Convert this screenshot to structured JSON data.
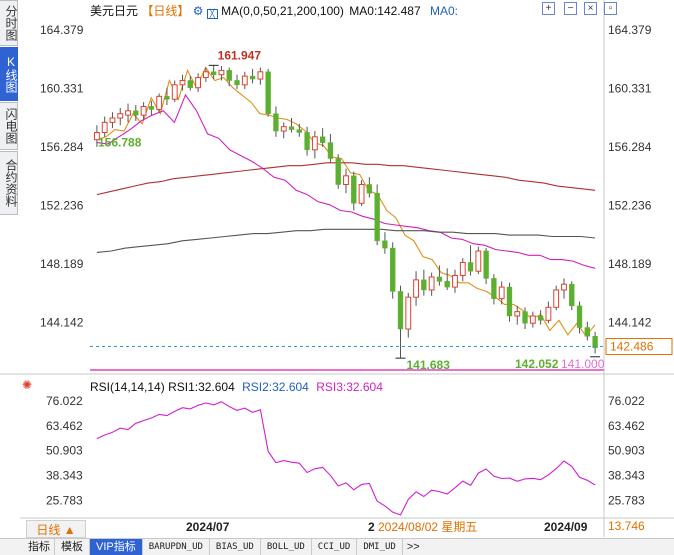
{
  "left_tabs": [
    "分时图",
    "K线图",
    "闪电图",
    "合约资料"
  ],
  "active_left_tab": 1,
  "header": {
    "symbol": "美元日元",
    "period": "【日线】",
    "ma_label": "MA(0,0,50,21,200,100)",
    "ma0_label": "MA0:142.487",
    "ma0b_label": "MA0:"
  },
  "rsi_header": {
    "title": "RSI(14,14,14)",
    "rsi1": "RSI1:32.604",
    "rsi2": "RSI2:32.604",
    "rsi3": "RSI3:32.604"
  },
  "colors": {
    "up": "#e04030",
    "down": "#5cb030",
    "ma_orange": "#e0901a",
    "ma_magenta": "#d020c0",
    "ma_darkred": "#b03030",
    "ma_gray": "#555555",
    "rsi": "#d020d0",
    "current_line": "#2a9fc0",
    "min_line": "#e040c0",
    "label_blue": "#2060c0"
  },
  "icons": [
    "add-box-icon",
    "minus-box-icon",
    "cross-box-icon",
    "expand-box-icon",
    "collapse-box-icon",
    "settings-gear-icon"
  ],
  "bottom_tabs": [
    "指标",
    "模板"
  ],
  "active_indicator_tab": "VIP指标",
  "indicator_tabs": [
    "BARUPDN_UD",
    "BIAS_UD",
    "BOLL_UD",
    "CCI_UD",
    "DMI_UD"
  ],
  "more_label": ">>",
  "period_label": "日线 ▲",
  "chart_data": {
    "type": "candlestick",
    "price_axis": {
      "ticks": [
        "164.379",
        "160.331",
        "156.284",
        "152.236",
        "148.189",
        "144.142"
      ],
      "ylim": [
        141.0,
        165.5
      ]
    },
    "rsi_axis": {
      "ticks": [
        "76.022",
        "63.462",
        "50.903",
        "38.343",
        "25.783"
      ],
      "ylim": [
        19.0,
        80.5
      ],
      "right_extra_label": "13.746"
    },
    "x_labels": [
      "2024/07",
      "2",
      "2024/09"
    ],
    "cursor_date_label": "2024/08/02 星期五",
    "annotations": {
      "high": "161.947",
      "left_value": "156.788",
      "low": "141.683",
      "last_close": "142.052",
      "min_level": "141.000",
      "current_price": "142.486"
    },
    "candles": [
      {
        "o": 156.8,
        "h": 157.8,
        "l": 156.3,
        "c": 157.3
      },
      {
        "o": 157.3,
        "h": 158.4,
        "l": 157.0,
        "c": 158.0
      },
      {
        "o": 158.0,
        "h": 158.7,
        "l": 157.6,
        "c": 158.3
      },
      {
        "o": 158.3,
        "h": 159.0,
        "l": 157.8,
        "c": 158.6
      },
      {
        "o": 158.5,
        "h": 159.3,
        "l": 158.0,
        "c": 158.8
      },
      {
        "o": 158.8,
        "h": 159.2,
        "l": 158.1,
        "c": 158.5
      },
      {
        "o": 158.5,
        "h": 159.4,
        "l": 158.2,
        "c": 159.1
      },
      {
        "o": 159.1,
        "h": 159.5,
        "l": 158.5,
        "c": 158.9
      },
      {
        "o": 158.9,
        "h": 160.0,
        "l": 158.7,
        "c": 159.8
      },
      {
        "o": 159.8,
        "h": 160.4,
        "l": 159.2,
        "c": 159.6
      },
      {
        "o": 159.6,
        "h": 160.9,
        "l": 159.4,
        "c": 160.6
      },
      {
        "o": 160.6,
        "h": 161.3,
        "l": 160.2,
        "c": 160.9
      },
      {
        "o": 160.9,
        "h": 161.2,
        "l": 160.2,
        "c": 160.4
      },
      {
        "o": 160.4,
        "h": 161.4,
        "l": 160.1,
        "c": 161.1
      },
      {
        "o": 161.1,
        "h": 161.8,
        "l": 160.8,
        "c": 161.5
      },
      {
        "o": 161.5,
        "h": 161.95,
        "l": 161.0,
        "c": 161.3
      },
      {
        "o": 161.3,
        "h": 161.9,
        "l": 160.9,
        "c": 161.6
      },
      {
        "o": 161.6,
        "h": 161.8,
        "l": 160.5,
        "c": 160.9
      },
      {
        "o": 160.9,
        "h": 161.3,
        "l": 160.3,
        "c": 160.6
      },
      {
        "o": 160.6,
        "h": 161.5,
        "l": 160.3,
        "c": 161.2
      },
      {
        "o": 161.2,
        "h": 161.7,
        "l": 160.7,
        "c": 161.0
      },
      {
        "o": 161.0,
        "h": 161.8,
        "l": 160.6,
        "c": 161.5
      },
      {
        "o": 161.5,
        "h": 161.7,
        "l": 158.4,
        "c": 158.6
      },
      {
        "o": 158.6,
        "h": 159.1,
        "l": 157.0,
        "c": 157.4
      },
      {
        "o": 157.4,
        "h": 158.0,
        "l": 156.9,
        "c": 157.7
      },
      {
        "o": 157.7,
        "h": 158.3,
        "l": 157.3,
        "c": 157.5
      },
      {
        "o": 157.5,
        "h": 157.9,
        "l": 157.0,
        "c": 157.3
      },
      {
        "o": 157.3,
        "h": 157.7,
        "l": 155.7,
        "c": 156.1
      },
      {
        "o": 156.1,
        "h": 157.4,
        "l": 155.5,
        "c": 157.0
      },
      {
        "o": 157.0,
        "h": 157.6,
        "l": 156.3,
        "c": 156.6
      },
      {
        "o": 156.6,
        "h": 157.2,
        "l": 155.2,
        "c": 155.5
      },
      {
        "o": 155.5,
        "h": 155.8,
        "l": 153.4,
        "c": 153.7
      },
      {
        "o": 153.7,
        "h": 154.8,
        "l": 153.1,
        "c": 154.3
      },
      {
        "o": 154.3,
        "h": 154.6,
        "l": 151.9,
        "c": 152.4
      },
      {
        "o": 152.4,
        "h": 154.0,
        "l": 152.2,
        "c": 153.7
      },
      {
        "o": 153.7,
        "h": 154.2,
        "l": 152.8,
        "c": 153.1
      },
      {
        "o": 153.1,
        "h": 153.7,
        "l": 149.5,
        "c": 149.8
      },
      {
        "o": 149.8,
        "h": 150.4,
        "l": 148.9,
        "c": 149.3
      },
      {
        "o": 149.3,
        "h": 149.7,
        "l": 145.8,
        "c": 146.3
      },
      {
        "o": 146.3,
        "h": 146.7,
        "l": 141.683,
        "c": 143.7
      },
      {
        "o": 143.7,
        "h": 146.2,
        "l": 143.1,
        "c": 145.9
      },
      {
        "o": 145.9,
        "h": 147.7,
        "l": 145.3,
        "c": 147.1
      },
      {
        "o": 147.1,
        "h": 147.8,
        "l": 146.0,
        "c": 146.4
      },
      {
        "o": 146.4,
        "h": 147.6,
        "l": 146.0,
        "c": 147.3
      },
      {
        "o": 147.3,
        "h": 148.1,
        "l": 146.7,
        "c": 147.0
      },
      {
        "o": 147.0,
        "h": 147.9,
        "l": 146.4,
        "c": 146.6
      },
      {
        "o": 146.6,
        "h": 147.8,
        "l": 146.2,
        "c": 147.4
      },
      {
        "o": 147.4,
        "h": 148.6,
        "l": 147.0,
        "c": 148.3
      },
      {
        "o": 148.3,
        "h": 149.5,
        "l": 147.4,
        "c": 147.7
      },
      {
        "o": 147.7,
        "h": 149.4,
        "l": 147.5,
        "c": 149.1
      },
      {
        "o": 149.1,
        "h": 149.3,
        "l": 146.8,
        "c": 147.2
      },
      {
        "o": 147.2,
        "h": 147.5,
        "l": 145.4,
        "c": 145.8
      },
      {
        "o": 145.8,
        "h": 147.0,
        "l": 145.4,
        "c": 146.6
      },
      {
        "o": 146.6,
        "h": 146.9,
        "l": 144.2,
        "c": 144.6
      },
      {
        "o": 144.6,
        "h": 145.3,
        "l": 144.0,
        "c": 144.9
      },
      {
        "o": 144.9,
        "h": 145.2,
        "l": 143.7,
        "c": 144.1
      },
      {
        "o": 144.1,
        "h": 144.9,
        "l": 143.8,
        "c": 144.6
      },
      {
        "o": 144.6,
        "h": 145.0,
        "l": 144.0,
        "c": 144.3
      },
      {
        "o": 144.3,
        "h": 145.6,
        "l": 144.1,
        "c": 145.2
      },
      {
        "o": 145.2,
        "h": 146.7,
        "l": 145.0,
        "c": 146.4
      },
      {
        "o": 146.4,
        "h": 147.2,
        "l": 145.8,
        "c": 146.8
      },
      {
        "o": 146.8,
        "h": 147.0,
        "l": 145.0,
        "c": 145.3
      },
      {
        "o": 145.3,
        "h": 145.6,
        "l": 143.4,
        "c": 143.8
      },
      {
        "o": 143.8,
        "h": 144.2,
        "l": 142.9,
        "c": 143.2
      },
      {
        "o": 143.2,
        "h": 143.5,
        "l": 142.0,
        "c": 142.4
      }
    ],
    "ma_orange": [
      [
        156.8,
        157.0
      ],
      [
        157.5,
        157.4
      ],
      [
        158.6,
        157.9
      ],
      [
        159.7,
        158.6
      ],
      [
        160.9,
        159.6
      ],
      [
        161.6,
        160.4
      ],
      [
        161.8,
        160.9
      ],
      [
        161.1,
        160.4
      ],
      [
        159.9,
        159.4
      ],
      [
        158.6,
        158.5
      ],
      [
        158.3,
        158.2
      ],
      [
        157.9,
        157.4
      ],
      [
        156.6,
        156.4
      ],
      [
        155.6,
        155.5
      ],
      [
        154.5,
        154.4
      ],
      [
        153.3,
        153.0
      ],
      [
        151.9,
        151.4
      ],
      [
        150.2,
        149.8
      ],
      [
        148.7,
        148.5
      ],
      [
        147.6,
        147.4
      ],
      [
        146.9,
        146.9
      ],
      [
        146.5,
        146.3
      ],
      [
        145.9,
        145.4
      ],
      [
        145.4,
        145.0
      ],
      [
        144.4,
        144.7
      ],
      [
        143.6,
        144.3
      ],
      [
        143.3,
        144.1
      ],
      [
        143.2,
        144.0
      ]
    ],
    "ma_magenta": [
      [
        156.6,
        156.5
      ],
      [
        157.0,
        157.5
      ],
      [
        158.1,
        158.5
      ],
      [
        158.8,
        158.0
      ],
      [
        159.9,
        158.8
      ],
      [
        157.2,
        156.9
      ],
      [
        156.1,
        155.7
      ],
      [
        155.3,
        154.8
      ],
      [
        154.2,
        154.0
      ],
      [
        153.3,
        153.0
      ],
      [
        152.5,
        152.3
      ],
      [
        151.9,
        151.8
      ],
      [
        151.5,
        151.3
      ],
      [
        151.0,
        150.9
      ],
      [
        150.8,
        150.7
      ],
      [
        150.5,
        150.4
      ],
      [
        150.0,
        149.9
      ],
      [
        149.6,
        149.5
      ],
      [
        149.2,
        149.1
      ],
      [
        149.0,
        148.8
      ],
      [
        148.8,
        148.5
      ],
      [
        148.5,
        148.4
      ],
      [
        148.1,
        147.9
      ]
    ],
    "ma_darkred": [
      [
        153.0,
        153.2
      ],
      [
        153.4,
        153.6
      ],
      [
        153.8,
        153.9
      ],
      [
        154.1,
        154.2
      ],
      [
        154.3,
        154.4
      ],
      [
        154.5,
        154.6
      ],
      [
        154.7,
        154.8
      ],
      [
        154.9,
        155.0
      ],
      [
        155.0,
        155.1
      ],
      [
        155.2,
        155.2
      ],
      [
        155.2,
        155.1
      ],
      [
        155.1,
        155.0
      ],
      [
        155.0,
        154.9
      ],
      [
        154.8,
        154.7
      ],
      [
        154.6,
        154.5
      ],
      [
        154.4,
        154.3
      ],
      [
        154.2,
        154.0
      ],
      [
        153.9,
        153.8
      ],
      [
        153.6,
        153.5
      ],
      [
        153.4,
        153.3
      ]
    ],
    "ma_gray": [
      [
        149.0,
        149.1
      ],
      [
        149.3,
        149.4
      ],
      [
        149.5,
        149.6
      ],
      [
        149.8,
        149.9
      ],
      [
        150.0,
        150.1
      ],
      [
        150.2,
        150.3
      ],
      [
        150.3,
        150.4
      ],
      [
        150.5,
        150.5
      ],
      [
        150.6,
        150.6
      ],
      [
        150.6,
        150.6
      ],
      [
        150.6,
        150.5
      ],
      [
        150.5,
        150.5
      ],
      [
        150.4,
        150.4
      ],
      [
        150.3,
        150.3
      ],
      [
        150.3,
        150.2
      ],
      [
        150.2,
        150.2
      ],
      [
        150.1,
        150.1
      ],
      [
        150.1,
        150.0
      ]
    ],
    "rsi": [
      57.0,
      58.8,
      60.2,
      62.3,
      61.5,
      64.7,
      66.1,
      67.4,
      69.2,
      68.6,
      70.7,
      72.6,
      72.0,
      73.8,
      75.0,
      74.0,
      75.6,
      73.2,
      71.2,
      72.4,
      70.2,
      71.6,
      50.5,
      44.9,
      45.9,
      45.1,
      44.6,
      39.9,
      41.8,
      42.5,
      38.5,
      33.1,
      34.7,
      31.2,
      33.9,
      34.4,
      25.5,
      23.1,
      19.9,
      18.5,
      26.4,
      30.2,
      27.8,
      31.0,
      30.3,
      29.1,
      32.2,
      35.6,
      33.4,
      39.6,
      41.7,
      38.1,
      36.9,
      37.1,
      35.5,
      36.7,
      37.0,
      36.3,
      38.7,
      41.9,
      45.7,
      43.0,
      37.5,
      36.0,
      33.6
    ]
  }
}
